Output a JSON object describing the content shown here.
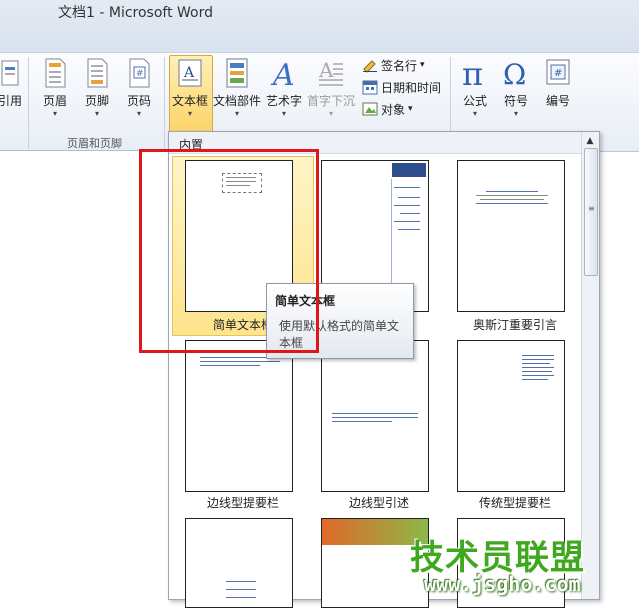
{
  "window": {
    "title": "文档1  -  Microsoft Word"
  },
  "ribbon": {
    "partial_left_label": "引用",
    "header_label": "页眉",
    "footer_label": "页脚",
    "pagenum_label": "页码",
    "group_header_footer": "页眉和页脚",
    "textbox_label": "文本框",
    "quickparts_label": "文档部件",
    "wordart_label": "艺术字",
    "dropcap_label": "首字下沉",
    "signature_label": "签名行",
    "signature_arrow": "▾",
    "datetime_label": "日期和时间",
    "object_label": "对象",
    "object_arrow": "▾",
    "equation_label": "公式",
    "symbol_label": "符号",
    "number_label": "编号"
  },
  "gallery": {
    "section_header": "内置",
    "items": [
      {
        "label": "简单文本框"
      },
      {
        "label": ""
      },
      {
        "label": "奥斯汀重要引言"
      },
      {
        "label": "边线型提要栏"
      },
      {
        "label": "边线型引述"
      },
      {
        "label": "传统型提要栏"
      }
    ]
  },
  "tooltip": {
    "title": "简单文本框",
    "description": "使用默认格式的简单文本框"
  },
  "watermark": {
    "main": "技术员联盟",
    "url": "www.jsgho.com"
  },
  "colors": {
    "highlight": "#fde48d",
    "red_box": "#e0171a",
    "watermark_green": "#3fa81e"
  }
}
